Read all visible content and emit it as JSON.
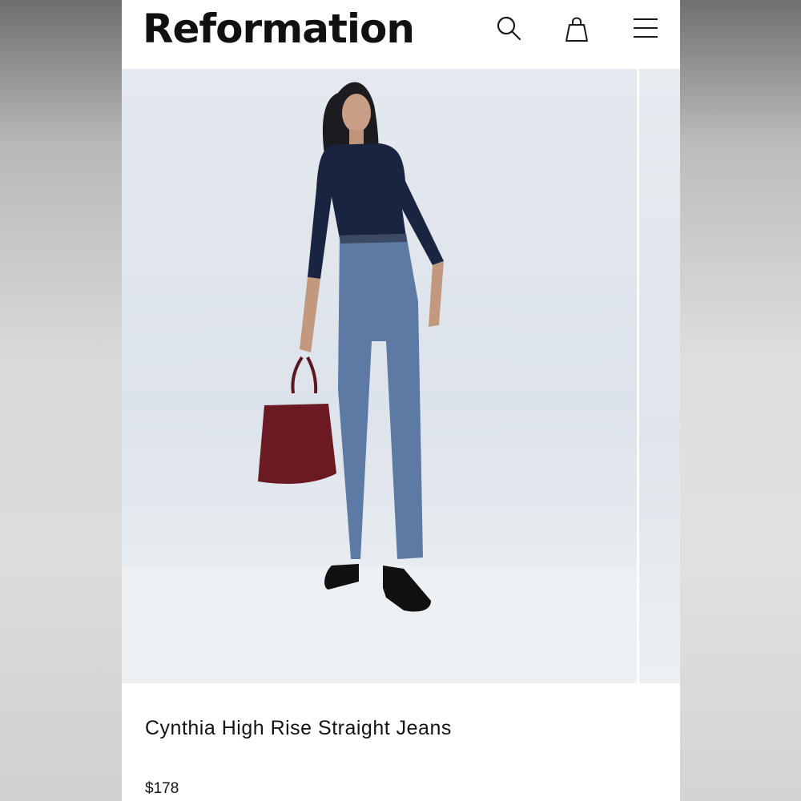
{
  "header": {
    "logo": "Reformation",
    "icons": [
      "search-icon",
      "shopping-bag-icon",
      "menu-icon"
    ]
  },
  "product": {
    "name": "Cynthia High Rise Straight Jeans",
    "price": "$178"
  },
  "colors": {
    "background": "#ffffff",
    "text": "#141414"
  }
}
